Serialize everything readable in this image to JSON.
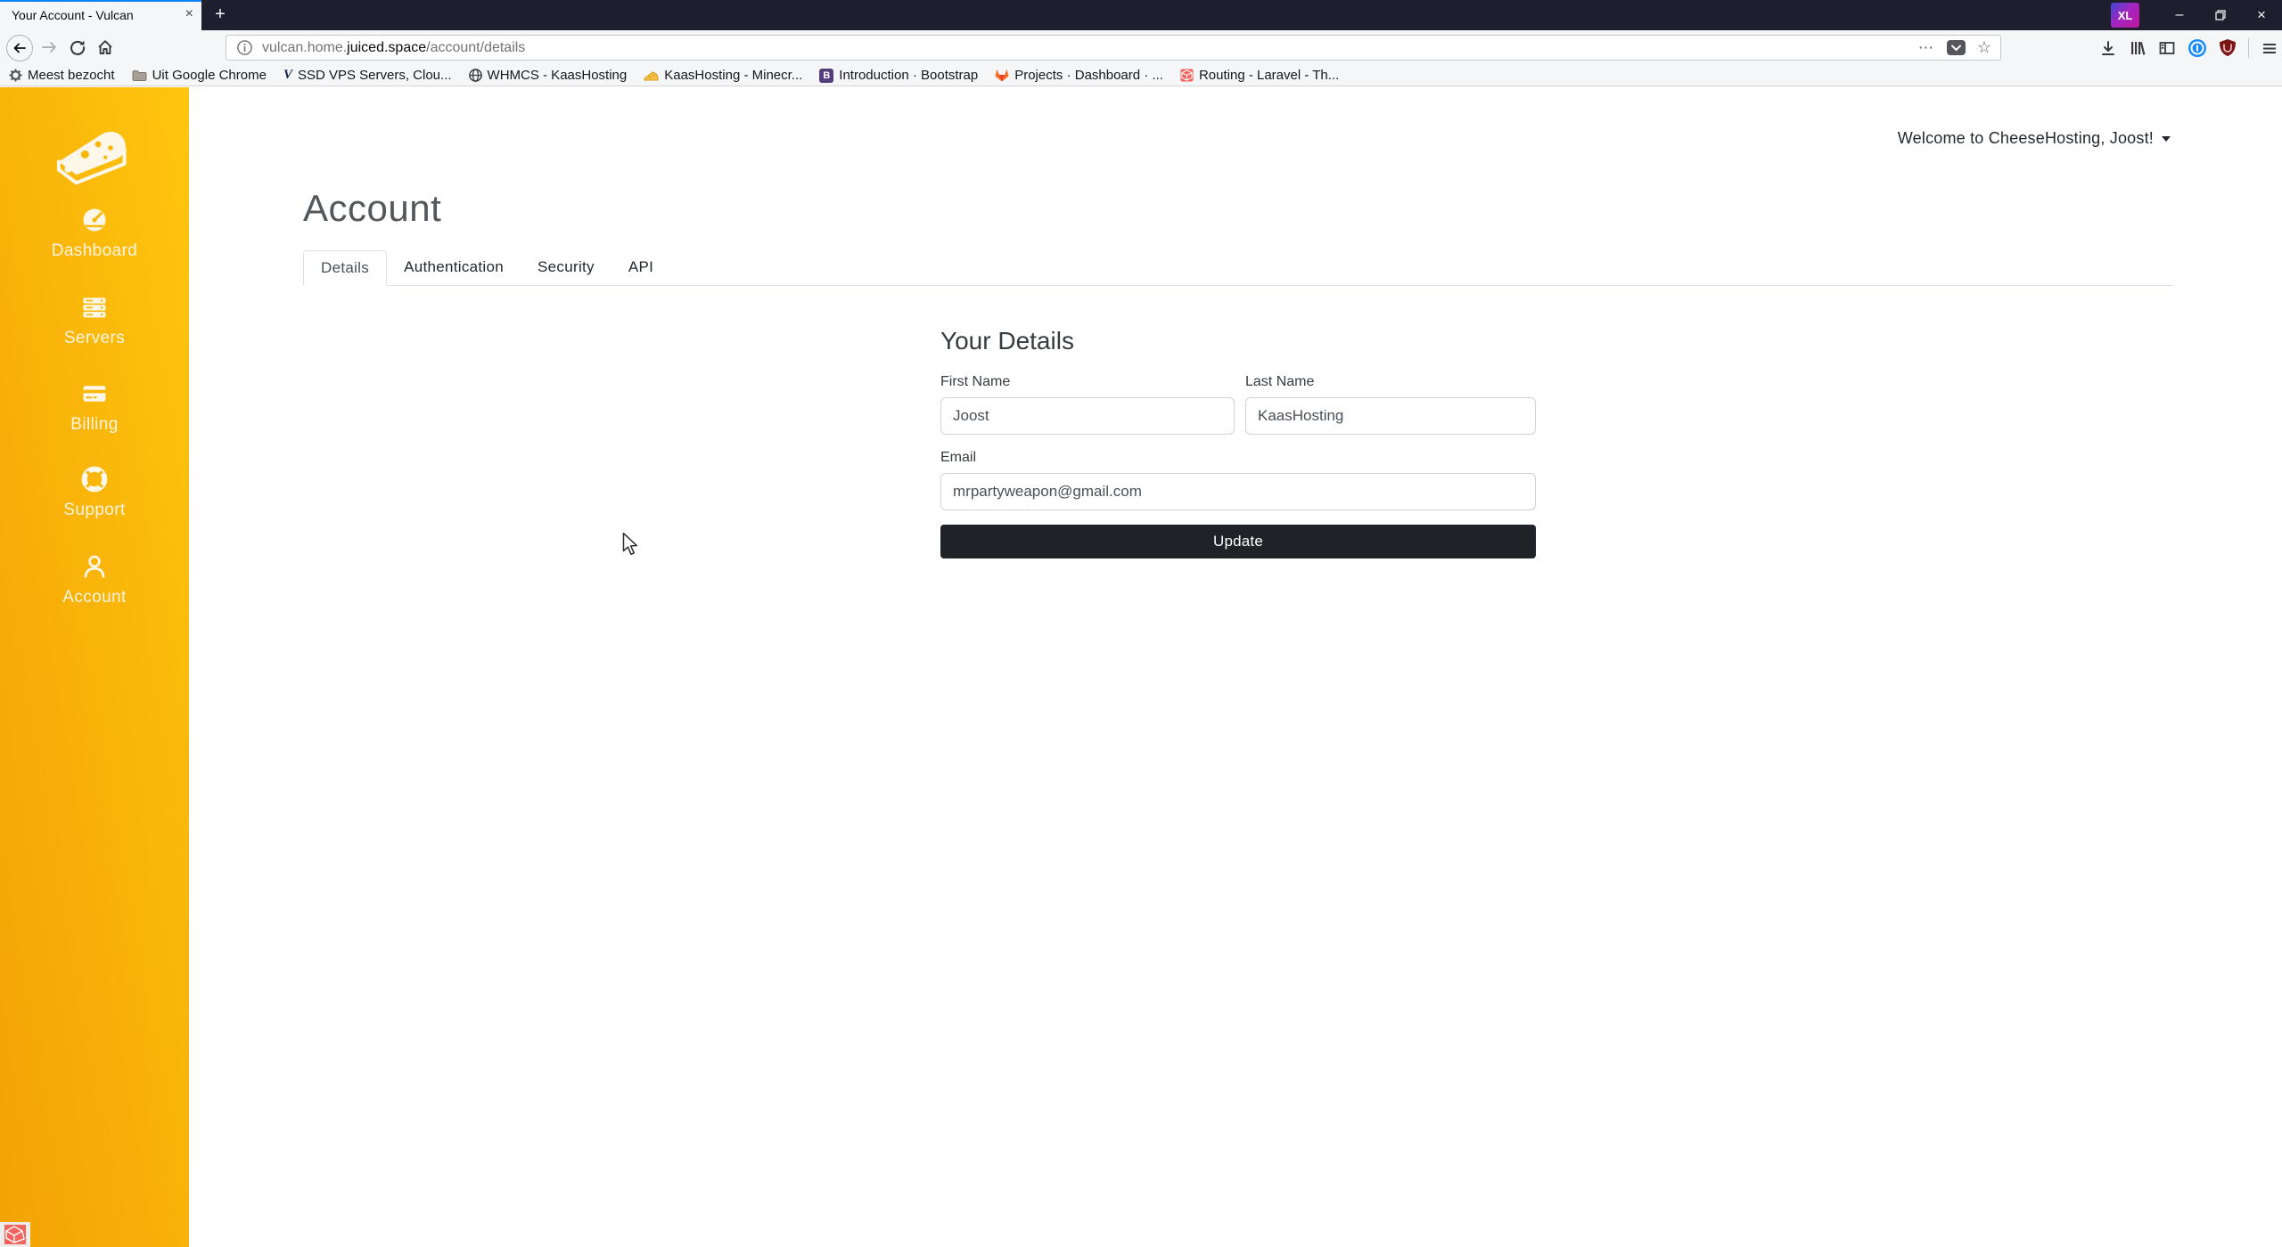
{
  "browser": {
    "tab": {
      "title": "Your Account - Vulcan"
    },
    "url": {
      "prefix": "vulcan.home.",
      "domain": "juiced.space",
      "path": "/account/details"
    },
    "bookmarks": [
      {
        "label": "Meest bezocht",
        "icon": "gear-icon"
      },
      {
        "label": "Uit Google Chrome",
        "icon": "folder-icon"
      },
      {
        "label": "SSD VPS Servers, Clou...",
        "icon": "vultr-icon"
      },
      {
        "label": "WHMCS - KaasHosting",
        "icon": "globe-icon"
      },
      {
        "label": "KaasHosting - Minecr...",
        "icon": "cheese-icon"
      },
      {
        "label": "Introduction · Bootstrap",
        "icon": "bootstrap-icon"
      },
      {
        "label": "Projects · Dashboard · ...",
        "icon": "gitlab-icon"
      },
      {
        "label": "Routing - Laravel - Th...",
        "icon": "laravel-icon"
      }
    ]
  },
  "icons": {
    "close": "×",
    "minimize": "–",
    "new_tab": "+",
    "overflow": "⋯",
    "bookmark_star": "☆",
    "ext_badge": "XL",
    "vultr_glyph": "V",
    "bootstrap_glyph": "B",
    "info_glyph": "i"
  },
  "sidebar": {
    "items": [
      {
        "label": "Dashboard",
        "icon": "speedometer-icon"
      },
      {
        "label": "Servers",
        "icon": "server-stack-icon"
      },
      {
        "label": "Billing",
        "icon": "credit-card-icon"
      },
      {
        "label": "Support",
        "icon": "life-ring-icon"
      },
      {
        "label": "Account",
        "icon": "person-icon"
      }
    ]
  },
  "header": {
    "welcome": "Welcome to CheeseHosting, Joost!"
  },
  "page": {
    "title": "Account",
    "tabs": [
      {
        "label": "Details",
        "active": true
      },
      {
        "label": "Authentication",
        "active": false
      },
      {
        "label": "Security",
        "active": false
      },
      {
        "label": "API",
        "active": false
      }
    ],
    "form": {
      "heading": "Your Details",
      "first_name": {
        "label": "First Name",
        "value": "Joost"
      },
      "last_name": {
        "label": "Last Name",
        "value": "KaasHosting"
      },
      "email": {
        "label": "Email",
        "value": "mrpartyweapon@gmail.com"
      },
      "submit_label": "Update"
    }
  },
  "colors": {
    "sidebar_gradient_start": "#f2a306",
    "sidebar_gradient_end": "#ffc60f",
    "active_tab_accent": "#0a84ff",
    "update_button": "#1f2327",
    "titlebar": "#1f1e2f"
  }
}
